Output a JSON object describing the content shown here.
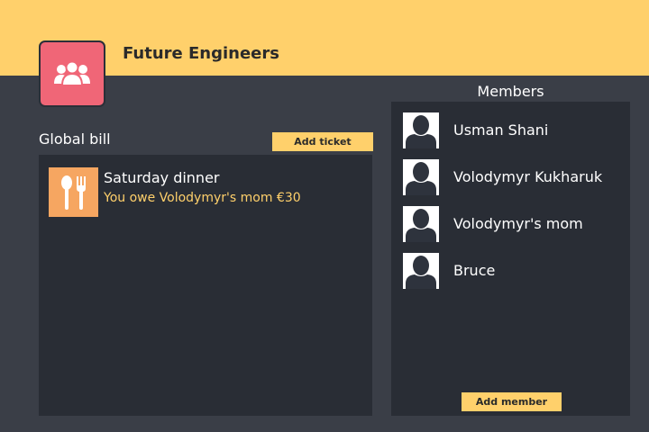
{
  "group": {
    "title": "Future Engineers",
    "avatar_icon": "group-people-icon",
    "avatar_color": "#f06677"
  },
  "colors": {
    "accent": "#ffd06b",
    "background": "#3a3e47",
    "panel": "#292d35",
    "ticket_icon_bg": "#f6a661"
  },
  "bill": {
    "title": "Global bill",
    "add_ticket_label": "Add ticket",
    "tickets": [
      {
        "icon": "spoon-fork-icon",
        "title": "Saturday dinner",
        "summary": "You owe Volodymyr's mom €30"
      }
    ]
  },
  "members": {
    "title": "Members",
    "add_member_label": "Add member",
    "items": [
      {
        "name": "Usman Shani",
        "icon": "user-silhouette-icon"
      },
      {
        "name": "Volodymyr Kukharuk",
        "icon": "user-silhouette-icon"
      },
      {
        "name": "Volodymyr's mom",
        "icon": "user-silhouette-icon"
      },
      {
        "name": "Bruce",
        "icon": "user-silhouette-icon"
      }
    ]
  }
}
